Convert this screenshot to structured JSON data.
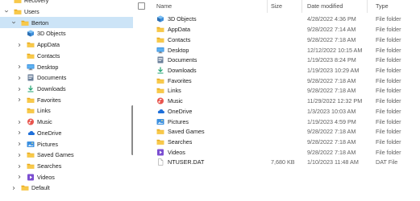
{
  "navigation": {
    "items": [
      {
        "label": "Recovery",
        "icon": "folder-icon",
        "chevron": "",
        "indent": 0,
        "selected": false
      },
      {
        "label": "Users",
        "icon": "folder-icon",
        "chevron": "down",
        "indent": 0,
        "selected": false
      },
      {
        "label": "Berton",
        "icon": "folder-icon",
        "chevron": "down",
        "indent": 1,
        "selected": true
      },
      {
        "label": "3D Objects",
        "icon": "cube-icon",
        "chevron": "",
        "indent": 2,
        "selected": false
      },
      {
        "label": "AppData",
        "icon": "folder-icon",
        "chevron": "right",
        "indent": 2,
        "selected": false
      },
      {
        "label": "Contacts",
        "icon": "folder-icon",
        "chevron": "",
        "indent": 2,
        "selected": false
      },
      {
        "label": "Desktop",
        "icon": "desktop-icon",
        "chevron": "right",
        "indent": 2,
        "selected": false
      },
      {
        "label": "Documents",
        "icon": "documents-icon",
        "chevron": "right",
        "indent": 2,
        "selected": false
      },
      {
        "label": "Downloads",
        "icon": "downloads-icon",
        "chevron": "right",
        "indent": 2,
        "selected": false
      },
      {
        "label": "Favorites",
        "icon": "folder-icon",
        "chevron": "right",
        "indent": 2,
        "selected": false
      },
      {
        "label": "Links",
        "icon": "folder-icon",
        "chevron": "",
        "indent": 2,
        "selected": false
      },
      {
        "label": "Music",
        "icon": "music-icon",
        "chevron": "right",
        "indent": 2,
        "selected": false
      },
      {
        "label": "OneDrive",
        "icon": "onedrive-icon",
        "chevron": "right",
        "indent": 2,
        "selected": false
      },
      {
        "label": "Pictures",
        "icon": "pictures-icon",
        "chevron": "right",
        "indent": 2,
        "selected": false
      },
      {
        "label": "Saved Games",
        "icon": "folder-icon",
        "chevron": "right",
        "indent": 2,
        "selected": false
      },
      {
        "label": "Searches",
        "icon": "folder-icon",
        "chevron": "right",
        "indent": 2,
        "selected": false
      },
      {
        "label": "Videos",
        "icon": "videos-icon",
        "chevron": "right",
        "indent": 2,
        "selected": false
      },
      {
        "label": "Default",
        "icon": "folder-icon",
        "chevron": "right",
        "indent": 1,
        "selected": false
      }
    ]
  },
  "columns": {
    "name": "Name",
    "size": "Size",
    "date": "Date modified",
    "type": "Type"
  },
  "files": [
    {
      "name": "3D Objects",
      "icon": "cube-icon",
      "size": "",
      "date": "4/28/2022 4:36 PM",
      "type": "File folder"
    },
    {
      "name": "AppData",
      "icon": "folder-icon",
      "size": "",
      "date": "9/28/2022 7:14 AM",
      "type": "File folder"
    },
    {
      "name": "Contacts",
      "icon": "folder-icon",
      "size": "",
      "date": "9/28/2022 7:18 AM",
      "type": "File folder"
    },
    {
      "name": "Desktop",
      "icon": "desktop-icon",
      "size": "",
      "date": "12/12/2022 10:15 AM",
      "type": "File folder"
    },
    {
      "name": "Documents",
      "icon": "documents-icon",
      "size": "",
      "date": "1/19/2023 8:24 PM",
      "type": "File folder"
    },
    {
      "name": "Downloads",
      "icon": "downloads-icon",
      "size": "",
      "date": "1/19/2023 10:29 AM",
      "type": "File folder"
    },
    {
      "name": "Favorites",
      "icon": "folder-icon",
      "size": "",
      "date": "9/28/2022 7:18 AM",
      "type": "File folder"
    },
    {
      "name": "Links",
      "icon": "folder-icon",
      "size": "",
      "date": "9/28/2022 7:18 AM",
      "type": "File folder"
    },
    {
      "name": "Music",
      "icon": "music-icon",
      "size": "",
      "date": "11/29/2022 12:32 PM",
      "type": "File folder"
    },
    {
      "name": "OneDrive",
      "icon": "onedrive-icon",
      "size": "",
      "date": "1/3/2023 10:03 AM",
      "type": "File folder"
    },
    {
      "name": "Pictures",
      "icon": "pictures-icon",
      "size": "",
      "date": "1/19/2023 4:59 PM",
      "type": "File folder"
    },
    {
      "name": "Saved Games",
      "icon": "folder-icon",
      "size": "",
      "date": "9/28/2022 7:18 AM",
      "type": "File folder"
    },
    {
      "name": "Searches",
      "icon": "folder-icon",
      "size": "",
      "date": "9/28/2022 7:18 AM",
      "type": "File folder"
    },
    {
      "name": "Videos",
      "icon": "videos-icon",
      "size": "",
      "date": "9/28/2022 7:18 AM",
      "type": "File folder"
    },
    {
      "name": "NTUSER.DAT",
      "icon": "file-icon",
      "size": "7,680 KB",
      "date": "1/10/2023 11:48 AM",
      "type": "DAT File"
    }
  ],
  "colors": {
    "selection": "#cce4f7",
    "folder": "#f8c94a",
    "accent": "#1e6fd9"
  }
}
